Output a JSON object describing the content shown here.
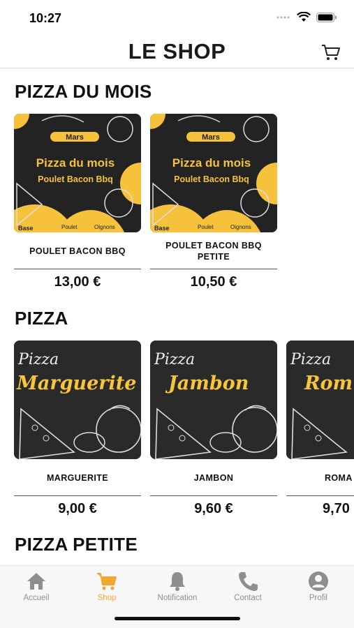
{
  "status_bar": {
    "time": "10:27"
  },
  "header": {
    "title": "LE SHOP",
    "cart_icon": "cart-icon"
  },
  "sections": [
    {
      "title": "PIZZA DU MOIS",
      "items": [
        {
          "name": "POULET BACON BBQ",
          "price": "13,00 €",
          "image": {
            "month": "Mars",
            "heading": "Pizza du mois",
            "sub": "Poulet Bacon Bbq",
            "labels": [
              "Base",
              "Poulet",
              "Oignons"
            ]
          }
        },
        {
          "name": "POULET BACON BBQ PETITE",
          "price": "10,50 €",
          "image": {
            "month": "Mars",
            "heading": "Pizza du mois",
            "sub": "Poulet Bacon Bbq",
            "labels": [
              "Base",
              "Poulet",
              "Oignons"
            ]
          }
        }
      ]
    },
    {
      "title": "PIZZA",
      "items": [
        {
          "name": "MARGUERITE",
          "price": "9,00 €",
          "image": {
            "script": "Pizza",
            "neon": "Marguerite"
          }
        },
        {
          "name": "JAMBON",
          "price": "9,60 €",
          "image": {
            "script": "Pizza",
            "neon": "Jambon"
          }
        },
        {
          "name": "ROMA",
          "price": "9,70",
          "image": {
            "script": "Pizza",
            "neon": "Rom"
          }
        }
      ]
    },
    {
      "title": "PIZZA PETITE",
      "items": []
    }
  ],
  "tabbar": {
    "accent": "#f0a830",
    "inactive": "#8e8e8e",
    "tabs": [
      {
        "label": "Accueil",
        "icon": "home-icon"
      },
      {
        "label": "Shop",
        "icon": "shopping-cart-icon",
        "active": true
      },
      {
        "label": "Notification",
        "icon": "bell-icon"
      },
      {
        "label": "Contact",
        "icon": "phone-icon"
      },
      {
        "label": "Profil",
        "icon": "user-icon"
      }
    ]
  }
}
